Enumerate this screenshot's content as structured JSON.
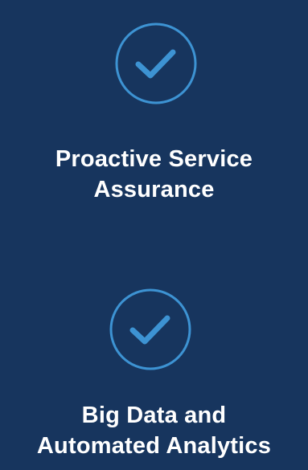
{
  "theme": {
    "background": "#17355e",
    "accent": "#3d93d3",
    "text": "#ffffff"
  },
  "features": [
    {
      "icon": "check-circle-icon",
      "title_line1": "Proactive Service",
      "title_line2": "Assurance"
    },
    {
      "icon": "check-circle-icon",
      "title_line1": "Big Data and",
      "title_line2": "Automated Analytics"
    }
  ]
}
